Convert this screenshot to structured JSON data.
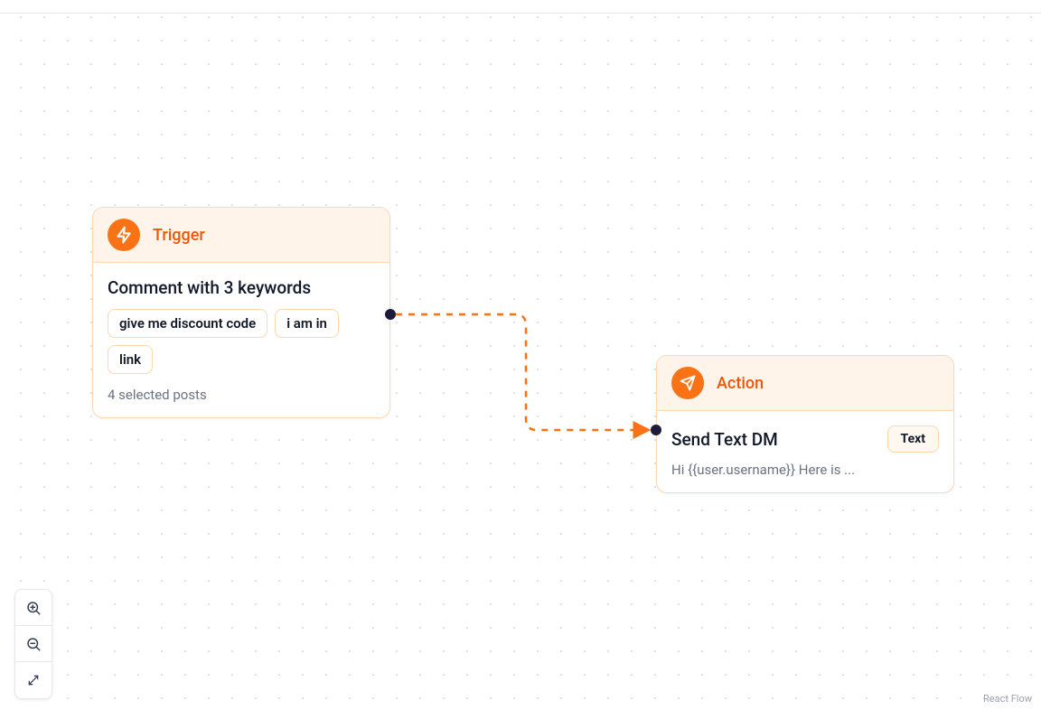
{
  "trigger": {
    "type_label": "Trigger",
    "title": "Comment with 3 keywords",
    "keywords": [
      "give me discount code",
      "i am in",
      "link"
    ],
    "footer": "4 selected posts"
  },
  "action": {
    "type_label": "Action",
    "title": "Send Text DM",
    "badge": "Text",
    "preview": "Hi {{user.username}} Here is ..."
  },
  "attribution": "React Flow"
}
